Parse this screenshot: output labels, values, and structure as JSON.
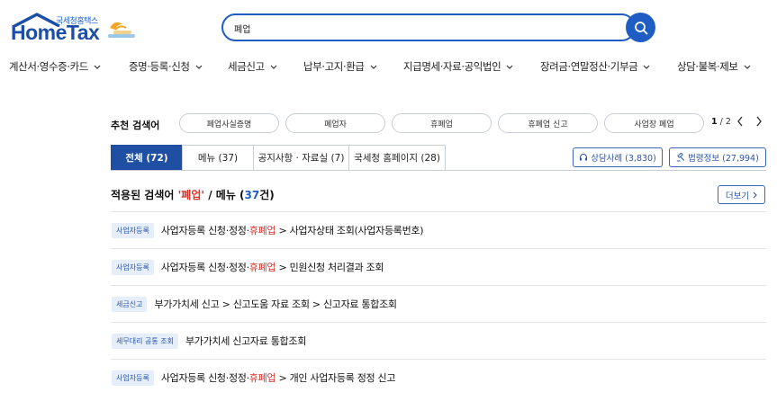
{
  "header": {
    "logo_sub": "국세청홈택스",
    "logo_main": "HomeTax",
    "search_value": "폐업"
  },
  "gnb": [
    {
      "label": "계산서·영수증·카드"
    },
    {
      "label": "증명·등록·신청"
    },
    {
      "label": "세금신고"
    },
    {
      "label": "납부·고지·환급"
    },
    {
      "label": "지급명세·자료·공익법인"
    },
    {
      "label": "장려금·연말정산·기부금"
    },
    {
      "label": "상담·불복·제보"
    }
  ],
  "recommend": {
    "title": "추천 검색어",
    "chips": [
      "폐업사실증명",
      "폐업자",
      "휴폐업",
      "휴폐업 신고",
      "사업장 폐업"
    ],
    "page_current": "1",
    "page_sep": " / 2"
  },
  "tabs": [
    {
      "label": "전체 (72)"
    },
    {
      "label": "메뉴 (37)"
    },
    {
      "label": "공지사항 · 자료실 (7)"
    },
    {
      "label": "국세청 홈페이지 (28)"
    }
  ],
  "tab_buttons": {
    "consult": "상담사례 (3,830)",
    "law": "법령정보 (27,994)"
  },
  "result_head": {
    "prefix": "적용된 검색어 ",
    "keyword": "'폐업'",
    "middle": " / 메뉴 (",
    "count": "37",
    "suffix": "건)",
    "more": "더보기"
  },
  "rows": [
    {
      "badge": "사업자등록",
      "pre": "사업자등록 신청·정정·",
      "hl": "휴폐업",
      "post": " > 사업자상태 조회(사업자등록번호)"
    },
    {
      "badge": "사업자등록",
      "pre": "사업자등록 신청·정정·",
      "hl": "휴폐업",
      "post": " > 민원신청 처리결과 조회"
    },
    {
      "badge": "세금신고",
      "pre": "부가가치세 신고 > 신고도움 자료 조회 > 신고자료 통합조회",
      "hl": "",
      "post": ""
    },
    {
      "badge": "세무대리 공통 조회",
      "pre": "부가가치세 신고자료 통합조회",
      "hl": "",
      "post": ""
    },
    {
      "badge": "사업자등록",
      "pre": "사업자등록 신청·정정·",
      "hl": "휴폐업",
      "post": " > 개인 사업자등록 정정 신고"
    }
  ],
  "colors": {
    "primary": "#1f5dc4",
    "tab_active": "#1f4fa3",
    "highlight": "#d9342b",
    "badge_bg": "#e6eefb"
  }
}
